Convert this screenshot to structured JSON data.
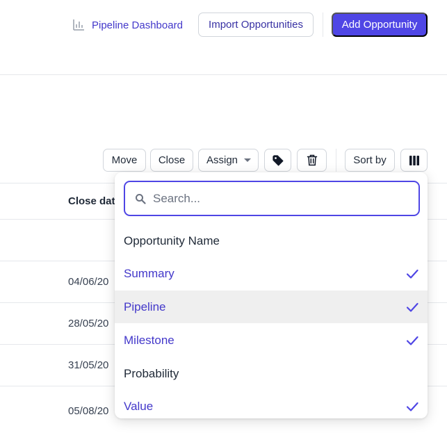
{
  "header": {
    "pipeline_link": "Pipeline Dashboard",
    "pipeline_icon": "bar-chart-icon",
    "import_label": "Import Opportunities",
    "add_label": "Add Opportunity"
  },
  "toolbar": {
    "move": "Move",
    "close": "Close",
    "assign": "Assign",
    "tag_icon": "tag-icon",
    "trash_icon": "trash-icon",
    "sort": "Sort by",
    "columns_icon": "columns-icon"
  },
  "table": {
    "close_date_header": "Close dat",
    "rows": [
      "04/06/20",
      "28/05/20",
      "31/05/20",
      "05/08/20"
    ]
  },
  "column_menu": {
    "search_placeholder": "Search...",
    "items": [
      {
        "label": "Opportunity Name",
        "checked": false
      },
      {
        "label": "Summary",
        "checked": true
      },
      {
        "label": "Pipeline",
        "checked": true
      },
      {
        "label": "Milestone",
        "checked": true
      },
      {
        "label": "Probability",
        "checked": false
      },
      {
        "label": "Value",
        "checked": true
      }
    ]
  },
  "colors": {
    "accent": "#4f46e5",
    "accent_text": "#4338ca",
    "hover": "#efefef"
  }
}
